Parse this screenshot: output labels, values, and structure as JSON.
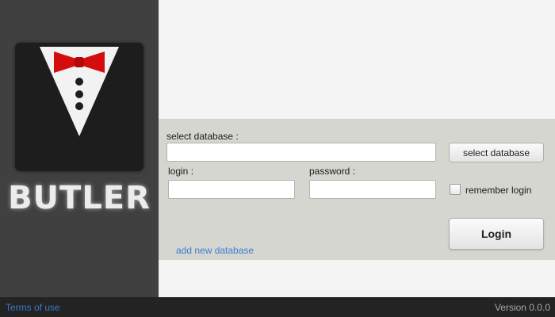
{
  "app": {
    "brand": "BUTLER"
  },
  "form": {
    "database_label": "select database :",
    "database_value": "",
    "select_database_button": "select database",
    "login_label": "login :",
    "login_value": "",
    "password_label": "password :",
    "password_value": "",
    "remember_label": "remember login",
    "remember_checked": false,
    "login_button": "Login",
    "add_database_link": "add new database"
  },
  "footer": {
    "terms_link": "Terms of use",
    "version": "Version 0.0.0"
  },
  "colors": {
    "sidebar": "#404040",
    "form_panel": "#d5d6d0",
    "footer": "#232323",
    "link": "#3a7fd0",
    "bowtie": "#d40c0c"
  },
  "icons": {
    "logo": "tuxedo-bowtie-icon"
  }
}
